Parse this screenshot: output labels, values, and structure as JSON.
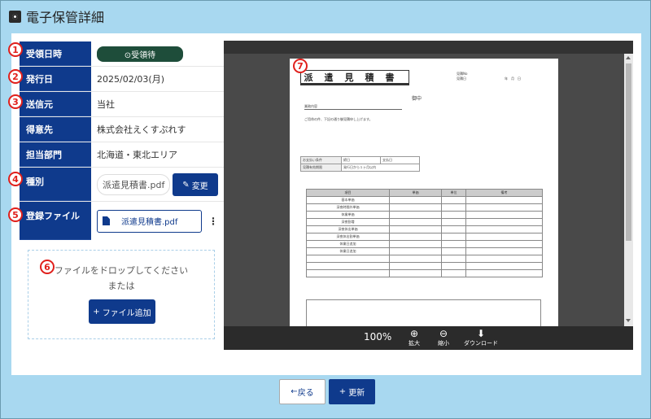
{
  "page_title": "電子保管詳細",
  "badges": [
    "1",
    "2",
    "3",
    "4",
    "5",
    "6",
    "7"
  ],
  "form": {
    "received_date": {
      "label": "受領日時",
      "status": "⊙受領待"
    },
    "issue_date": {
      "label": "発行日",
      "value": "2025/02/03(月)"
    },
    "sender": {
      "label": "送信元",
      "value": "当社"
    },
    "client": {
      "label": "得意先",
      "value": "株式会社えくすぷれす"
    },
    "department": {
      "label": "担当部門",
      "value": "北海道・東北エリア"
    },
    "type": {
      "label": "種別",
      "value": "派遣見積書.pdf",
      "change_label": "変更"
    },
    "file": {
      "label": "登録ファイル",
      "value": "派遣見積書.pdf",
      "more": "⋮"
    }
  },
  "dropzone": {
    "line1": "ファイルをドロップしてください",
    "line2": "または",
    "add_label": "ファイル追加"
  },
  "viewer": {
    "zoom": "100%",
    "zoom_in_label": "拡大",
    "zoom_out_label": "縮小",
    "download_label": "ダウンロード",
    "document": {
      "title": "派遣見積書",
      "meta1": "見積No",
      "meta2": "見積日",
      "date": "年　月　日",
      "recipient": "御中",
      "subject": "業務内容",
      "greeting": "ご用命の件、下記の通り御見積申し上げます。",
      "payment_label": "お支払い条件",
      "payment_1": "締日",
      "payment_2": "支払日",
      "validity_label": "見積有効期限",
      "validity_value": "発行日から１ヶ月以内",
      "col_item": "項目",
      "col_price": "単価",
      "col_qty": "単位",
      "col_note": "備考",
      "rows": [
        "基本単価",
        "深夜時間外単価",
        "休業単価",
        "深夜割増",
        "深夜休出単価",
        "深夜休出割単価",
        "休業日追加",
        "休業日追加"
      ]
    }
  },
  "footer": {
    "back_label": "戻る",
    "update_label": "更新"
  }
}
